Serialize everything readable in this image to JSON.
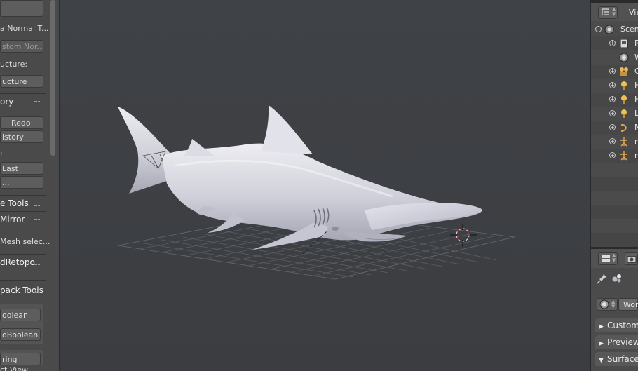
{
  "tool_shelf": {
    "normal_transfer_label": "a Normal T...",
    "custom_normals_label": "stom Nor...",
    "structure_label": "ucture:",
    "structure_button": "ucture",
    "history_header": "ory",
    "undo_label": "",
    "redo_label": "Redo",
    "undo_history_label": "istory",
    "repeat_header": ":",
    "repeat_last_label": "Last",
    "repeat_history_label": "...",
    "tools_header": "e Tools",
    "mirror_header": "Mirror",
    "mesh_select_label": "Mesh selec...",
    "retopo_header": "dRetopo",
    "pack_tools_header": "pack Tools",
    "boolean_button": "oolean",
    "auto_boolean_button": "oBoolean",
    "ring_button": "ring",
    "last_view_label": "ct View"
  },
  "outliner": {
    "view_label": "Vie",
    "rows": [
      {
        "label": "Scen",
        "expander": "−",
        "icon": "scene-icon"
      },
      {
        "label": "R",
        "expander": "+",
        "icon": "render-layers-icon"
      },
      {
        "label": "W",
        "expander": "",
        "icon": "world-icon"
      },
      {
        "label": "C",
        "expander": "+",
        "icon": "camera-icon"
      },
      {
        "label": "H",
        "expander": "+",
        "icon": "lamp-icon"
      },
      {
        "label": "H",
        "expander": "+",
        "icon": "lamp-icon"
      },
      {
        "label": "L",
        "expander": "+",
        "icon": "lamp-icon"
      },
      {
        "label": "N",
        "expander": "+",
        "icon": "curve-icon"
      },
      {
        "label": "n",
        "expander": "+",
        "icon": "armature-icon"
      },
      {
        "label": "n",
        "expander": "+",
        "icon": "armature-icon"
      }
    ]
  },
  "properties": {
    "world_field": "Wor",
    "panels": [
      {
        "label": "Custom",
        "triangle": "▶"
      },
      {
        "label": "Preview",
        "triangle": "▶"
      },
      {
        "label": "Surface",
        "triangle": "▼"
      }
    ]
  },
  "colors": {
    "viewport_bg": "#3d4044",
    "shark": "#d4d4de",
    "grid": "#5a5d60"
  }
}
